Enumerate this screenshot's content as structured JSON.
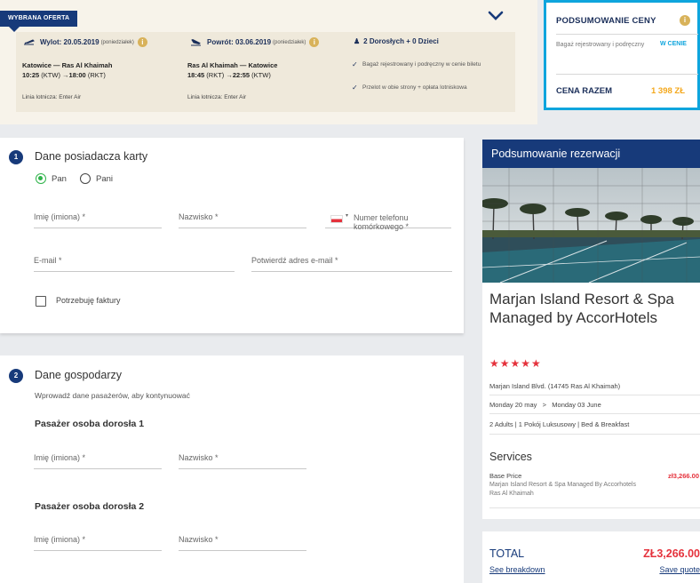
{
  "offer": {
    "tag": "WYBRANA OFERTA",
    "outbound": {
      "label": "Wylot: 20.05.2019",
      "day": "(poniedziałek)",
      "route": "Katowice — Ras Al Khaimah",
      "dep_time": "10:25",
      "dep_code": "(KTW)",
      "arr_time": "18:00",
      "arr_code": "(RKT)",
      "airline": "Linia lotnicza: Enter Air"
    },
    "return": {
      "label": "Powrót: 03.06.2019",
      "day": "(poniedziałek)",
      "route": "Ras Al Khaimah — Katowice",
      "dep_time": "18:45",
      "dep_code": "(RKT)",
      "arr_time": "22:55",
      "arr_code": "(KTW)",
      "airline": "Linia lotnicza: Enter Air"
    },
    "passengers": "2 Dorosłych + 0 Dzieci",
    "included": [
      "Bagaż rejestrowany i podręczny w cenie biletu",
      "Przelot w obie strony + opłata lotniskowa"
    ]
  },
  "price_summary": {
    "title": "PODSUMOWANIE CENY",
    "baggage_label": "Bagaż rejestrowany i podręczny",
    "baggage_value": "W CENIE",
    "total_label": "CENA RAZEM",
    "total_value": "1 398 ZŁ"
  },
  "card1": {
    "step": "1",
    "title": "Dane posiadacza karty",
    "radio_pan": "Pan",
    "radio_pani": "Pani",
    "first_name": "Imię (imiona) *",
    "last_name": "Nazwisko *",
    "phone": "Numer telefonu komórkowego *",
    "email": "E-mail *",
    "email_confirm": "Potwierdź adres e-mail *",
    "invoice": "Potrzebuję faktury"
  },
  "card2": {
    "step": "2",
    "title": "Dane gospodarzy",
    "hint": "Wprowadź dane pasażerów, aby kontynuować",
    "adult1": "Pasażer osoba dorosła 1",
    "adult2": "Pasażer osoba dorosła 2",
    "first_name": "Imię (imiona) *",
    "last_name": "Nazwisko *"
  },
  "booking": {
    "title": "Podsumowanie rezerwacji",
    "hotel_name": "Marjan Island Resort & Spa Managed by AccorHotels",
    "stars": "★★★★★",
    "address": "Marjan Island Blvd. (14745 Ras Al Khaimah)",
    "date_from": "Monday 20 may",
    "date_sep": ">",
    "date_to": "Monday 03 June",
    "room": "2 Adults | 1 Pokój Luksusowy | Bed & Breakfast",
    "services_title": "Services",
    "base_label": "Base Price",
    "base_price": "zł3,266.00",
    "base_desc": "Marjan Island Resort & Spa Managed By Accorhotels Ras Al Khaimah",
    "total_label": "TOTAL",
    "total_value": "ZŁ3,266.00",
    "see_breakdown": "See breakdown",
    "save_quote": "Save quote"
  },
  "colors": {
    "navy": "#173a7a",
    "accent_blue": "#0ea5dd",
    "orange": "#f4a81c",
    "red": "#e5323c",
    "green": "#2fb34a"
  }
}
